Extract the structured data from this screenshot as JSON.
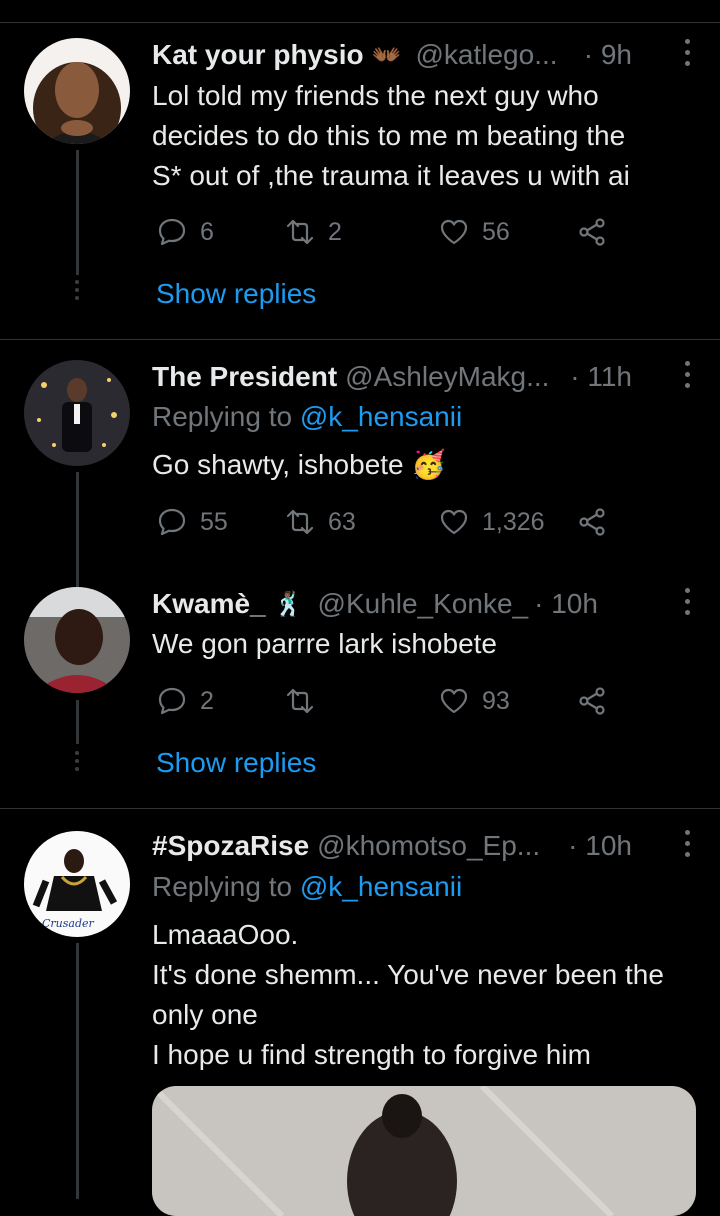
{
  "tweets": [
    {
      "name": "Kat your physio",
      "badge": "👐🏾",
      "handle": "@katlego...",
      "time": "· 9h",
      "replying_label": "",
      "replying_mention": "",
      "lines": [
        "Lol told my friends the next guy who",
        "decides to do this to me m beating the",
        "S* out of ,the trauma it leaves u with ai"
      ],
      "replies": "6",
      "retweets": "2",
      "likes": "56",
      "show_replies": "Show replies"
    },
    {
      "name": "The President",
      "badge": "",
      "handle": "@AshleyMakg...",
      "time": "· 11h",
      "replying_label": "Replying to",
      "replying_mention": "@k_hensanii",
      "lines": [
        "Go shawty, ishobete 🥳"
      ],
      "replies": "55",
      "retweets": "63",
      "likes": "1,326",
      "show_replies": ""
    },
    {
      "name": "Kwamè_",
      "badge": "🕺🏾",
      "handle": "@Kuhle_Konke_",
      "time": "· 10h",
      "replying_label": "",
      "replying_mention": "",
      "lines": [
        "We gon parrre lark ishobete"
      ],
      "replies": "2",
      "retweets": "",
      "likes": "93",
      "show_replies": "Show replies"
    },
    {
      "name": "#SpozaRise",
      "badge": "",
      "handle": "@khomotso_Ep...",
      "time": "· 10h",
      "replying_label": "Replying to",
      "replying_mention": "@k_hensanii",
      "lines": [
        "LmaaaOoo.",
        "It's done shemm... You've never been the",
        "only one",
        "I hope u find strength to forgive him"
      ],
      "replies": "",
      "retweets": "",
      "likes": "",
      "show_replies": "",
      "avatar_text": "Crusader"
    }
  ],
  "icons": {
    "reply": "reply-icon",
    "retweet": "retweet-icon",
    "like": "like-icon",
    "share": "share-icon",
    "more": "more-icon"
  },
  "colors": {
    "background": "#000000",
    "accent": "#1d9bf0",
    "muted": "#71767b",
    "text": "#e7e9ea"
  }
}
